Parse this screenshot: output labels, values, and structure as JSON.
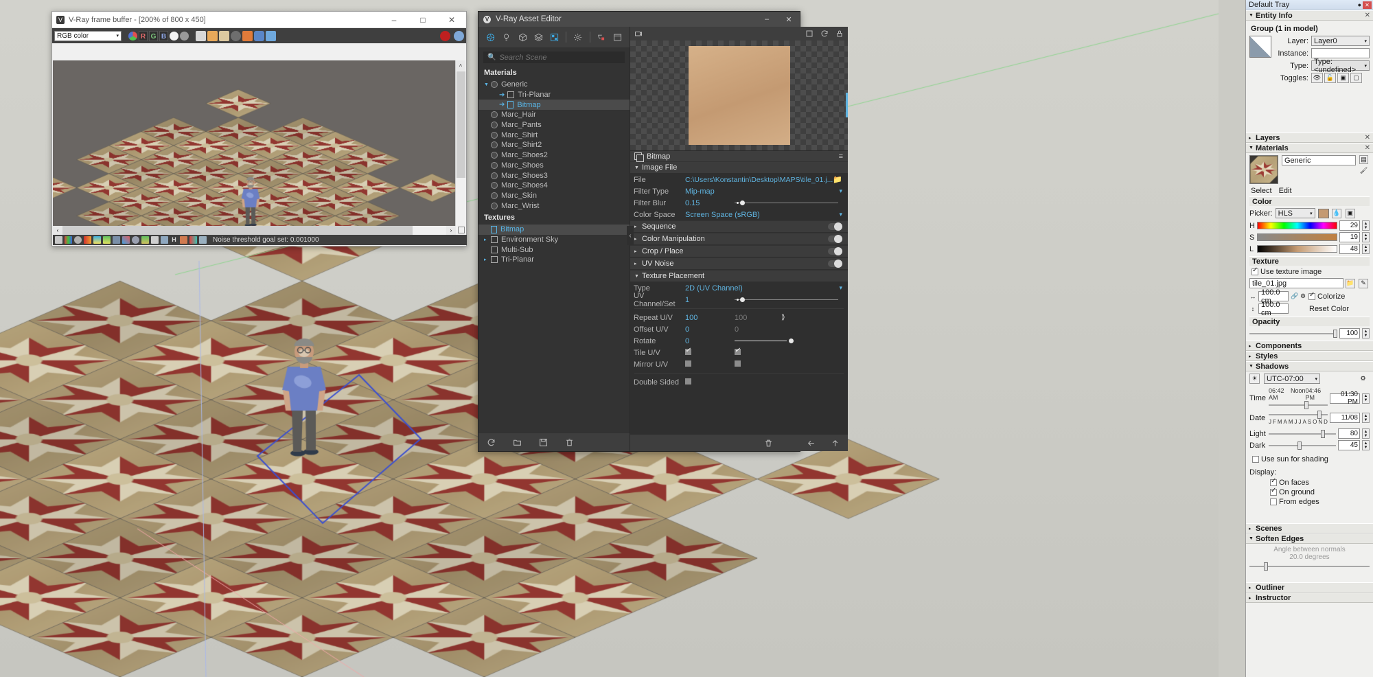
{
  "app": {
    "viewport_name": "sketchup-viewport"
  },
  "vfb": {
    "title": "V-Ray frame buffer - [200% of 800 x 450]",
    "title_icon": "vray-logo-icon",
    "minimize": "–",
    "maximize": "□",
    "close": "✕",
    "channel_select": "RGB color",
    "toolbar_icons": [
      "color-channels-icon",
      "red-channel-icon",
      "green-channel-icon",
      "blue-channel-icon",
      "alpha-icon",
      "monochrome-icon",
      "save-icon",
      "open-icon",
      "clipboard-icon",
      "clear-icon",
      "region-render-icon",
      "vray-teapot-icon",
      "stereo-icon"
    ],
    "toolbar_right_icons": [
      "stop-render-icon",
      "vray-render-icon"
    ],
    "status_text": "Noise threshold goal set: 0.001000",
    "status_icons": [
      "layers-icon",
      "color-corrections-icon",
      "info-icon",
      "exposure-icon",
      "hsl-icon",
      "color-balance-icon",
      "curve-icon",
      "lut-icon",
      "white-balance-icon",
      "hue-icon",
      "lens-effects-icon",
      "vignette-icon",
      "levels-icon",
      "h-icon",
      "compare-icon",
      "background-icon",
      "denoiser-icon"
    ],
    "scroll_up": "˄",
    "scroll_down": "˅",
    "scroll_left": "‹",
    "scroll_right": "›"
  },
  "asset_editor": {
    "title": "V-Ray Asset Editor",
    "title_icon": "vray-logo-icon",
    "minimize": "–",
    "maximize": "□",
    "close": "✕",
    "toolbar": [
      {
        "name": "materials-icon",
        "active": true
      },
      {
        "name": "lights-icon",
        "active": false
      },
      {
        "name": "geometry-icon",
        "active": false
      },
      {
        "name": "render-elements-icon",
        "active": false
      },
      {
        "name": "textures-icon",
        "active": true
      },
      {
        "name": "settings-gear-icon",
        "active": false
      },
      {
        "name": "render-with-vray-icon",
        "active": false
      },
      {
        "name": "frame-buffer-icon",
        "active": false
      }
    ],
    "search_placeholder": "Search Scene",
    "search_value": "",
    "search_icon": "search-icon",
    "tree": [
      {
        "type": "group",
        "label": "Materials"
      },
      {
        "type": "item",
        "label": "Generic",
        "icon": "sphere-icon",
        "indent": 0,
        "twisty": "▼",
        "selected": false
      },
      {
        "type": "item",
        "label": "Tri-Planar",
        "icon": "square-icon",
        "indent": 1,
        "arrow": "➔",
        "selected": false
      },
      {
        "type": "item",
        "label": "Bitmap",
        "icon": "doc-icon",
        "indent": 1,
        "arrow": "➔",
        "selected": true
      },
      {
        "type": "item",
        "label": "Marc_Hair",
        "icon": "sphere-icon",
        "indent": 0,
        "selected": false
      },
      {
        "type": "item",
        "label": "Marc_Pants",
        "icon": "sphere-icon",
        "indent": 0,
        "selected": false
      },
      {
        "type": "item",
        "label": "Marc_Shirt",
        "icon": "sphere-icon",
        "indent": 0,
        "selected": false
      },
      {
        "type": "item",
        "label": "Marc_Shirt2",
        "icon": "sphere-icon",
        "indent": 0,
        "selected": false
      },
      {
        "type": "item",
        "label": "Marc_Shoes2",
        "icon": "sphere-icon",
        "indent": 0,
        "selected": false
      },
      {
        "type": "item",
        "label": "Marc_Shoes",
        "icon": "sphere-icon",
        "indent": 0,
        "selected": false
      },
      {
        "type": "item",
        "label": "Marc_Shoes3",
        "icon": "sphere-icon",
        "indent": 0,
        "selected": false
      },
      {
        "type": "item",
        "label": "Marc_Shoes4",
        "icon": "sphere-icon",
        "indent": 0,
        "selected": false
      },
      {
        "type": "item",
        "label": "Marc_Skin",
        "icon": "sphere-icon",
        "indent": 0,
        "selected": false
      },
      {
        "type": "item",
        "label": "Marc_Wrist",
        "icon": "sphere-icon",
        "indent": 0,
        "selected": false
      },
      {
        "type": "group",
        "label": "Textures"
      },
      {
        "type": "item",
        "label": "Bitmap",
        "icon": "doc-icon",
        "indent": 0,
        "selected": true,
        "blue": true
      },
      {
        "type": "item",
        "label": "Environment Sky",
        "icon": "square-icon",
        "indent": 0,
        "twisty": "▸",
        "selected": false
      },
      {
        "type": "item",
        "label": "Multi-Sub",
        "icon": "square-icon",
        "indent": 0,
        "selected": false
      },
      {
        "type": "item",
        "label": "Tri-Planar",
        "icon": "square-icon",
        "indent": 0,
        "twisty": "▸",
        "selected": false
      }
    ],
    "left_footer_icons": [
      "refresh-icon",
      "open-folder-icon",
      "save-icon",
      "delete-icon"
    ],
    "right_footer_icons": [
      "purge-icon"
    ],
    "nav_icons": [
      "back-arrow-icon",
      "up-arrow-icon"
    ],
    "collapse_handle": "‹",
    "preview": {
      "camera_icon": "preview-camera-icon",
      "resize_icon": "maximize-preview-icon",
      "refresh_icon": "refresh-preview-icon",
      "lock_icon": "lock-preview-icon",
      "swatch_color": "#c89b72"
    },
    "prop_header": {
      "icon": "bitmap-icon",
      "title": "Bitmap",
      "menu": "≡"
    },
    "sections": {
      "image_file": {
        "label": "Image File",
        "expanded": true,
        "tri": "▼",
        "rows": [
          {
            "label": "File",
            "value": "C:\\Users\\Konstantin\\Desktop\\MAPS\\tile_01.j...",
            "control": "file",
            "icon": "folder-icon"
          },
          {
            "label": "Filter Type",
            "value": "Mip-map",
            "control": "dropdown",
            "chev": "▾"
          },
          {
            "label": "Filter Blur",
            "value": "0.15",
            "control": "slider",
            "knob_pct": 5
          },
          {
            "label": "Color Space",
            "value": "Screen Space (sRGB)",
            "control": "dropdown",
            "chev": "▾"
          }
        ]
      },
      "collapsed": [
        {
          "label": "Sequence",
          "tri": "▸",
          "toggle": true
        },
        {
          "label": "Color Manipulation",
          "tri": "▸",
          "toggle": false
        },
        {
          "label": "Crop / Place",
          "tri": "▸",
          "toggle": false
        },
        {
          "label": "UV Noise",
          "tri": "▸",
          "toggle": true
        }
      ],
      "texture_placement": {
        "label": "Texture Placement",
        "tri": "▼",
        "rows": [
          {
            "label": "Type",
            "value": "2D (UV Channel)",
            "control": "dropdown",
            "chev": "▾"
          },
          {
            "label": "UV Channel/Set",
            "value": "1",
            "control": "slider",
            "knob_pct": 5
          }
        ],
        "rows2": [
          {
            "label": "Repeat U/V",
            "u": "100",
            "v": "100",
            "control": "pair",
            "link_icon": "link-icon"
          },
          {
            "label": "Offset U/V",
            "u": "0",
            "v": "0",
            "control": "pair"
          },
          {
            "label": "Rotate",
            "u": "0",
            "control": "slider",
            "knob_pct": 52
          },
          {
            "label": "Tile U/V",
            "u_checked": true,
            "v_checked": true,
            "control": "checks"
          },
          {
            "label": "Mirror U/V",
            "u_checked": false,
            "v_checked": false,
            "control": "checks"
          },
          {
            "label": "Double Sided",
            "u_checked": false,
            "control": "check1"
          }
        ]
      }
    }
  },
  "tray": {
    "title": "Default Tray",
    "pin_icon": "pin-icon",
    "close_icon": "close-icon",
    "panels": [
      {
        "name": "entity-info",
        "label": "Entity Info",
        "tri": "▼",
        "close": "✕"
      },
      {
        "name": "layers",
        "label": "Layers",
        "tri": "▸",
        "close": "✕"
      },
      {
        "name": "materials",
        "label": "Materials",
        "tri": "▼",
        "close": "✕"
      },
      {
        "name": "components",
        "label": "Components",
        "tri": "▸",
        "close": ""
      },
      {
        "name": "styles",
        "label": "Styles",
        "tri": "▸",
        "close": ""
      },
      {
        "name": "shadows",
        "label": "Shadows",
        "tri": "▼",
        "close": ""
      },
      {
        "name": "scenes",
        "label": "Scenes",
        "tri": "▸",
        "close": ""
      },
      {
        "name": "soften-edges",
        "label": "Soften Edges",
        "tri": "▼",
        "close": ""
      },
      {
        "name": "outliner",
        "label": "Outliner",
        "tri": "▸",
        "close": ""
      },
      {
        "name": "instructor",
        "label": "Instructor",
        "tri": "▸",
        "close": ""
      }
    ],
    "entity_info": {
      "heading": "Group (1 in model)",
      "thumb_icon": "group-thumbnail",
      "layer_label": "Layer:",
      "layer_value": "Layer0",
      "instance_label": "Instance:",
      "instance_value": "",
      "type_label": "Type:",
      "type_value": "Type: <undefined>",
      "toggles_label": "Toggles:",
      "toggles": [
        "eye-icon",
        "unlock-icon",
        "cast-shadows-icon",
        "receive-shadows-icon"
      ]
    },
    "materials": {
      "swatch_name": "material-thumbnail",
      "name_value": "Generic",
      "select_tab": "Select",
      "edit_tab": "Edit",
      "color_label": "Color",
      "picker_label": "Picker:",
      "picker_value": "HLS",
      "h_label": "H",
      "h_value": "29",
      "s_label": "S",
      "s_value": "19",
      "l_label": "L",
      "l_value": "48",
      "texture_label": "Texture",
      "use_texture_label": "Use texture image",
      "use_texture_checked": true,
      "texture_file": "tile_01.jpg",
      "width_value": "100.0 cm",
      "height_value": "100.0 cm",
      "colorize_label": "Colorize",
      "colorize_checked": true,
      "reset_color_label": "Reset Color",
      "opacity_label": "Opacity",
      "opacity_value": "100",
      "browse_icon": "browse-icon",
      "eyedropper_icon": "eyedropper-icon",
      "matte_icon": "matte-icon",
      "lock_icon": "link-lock-icon"
    },
    "shadows": {
      "play_icon": "shadow-display-icon",
      "timezone": "UTC-07:00",
      "settings_icon": "shadow-settings-icon",
      "time_label": "Time",
      "time_start": "06:42 AM",
      "time_noon": "Noon",
      "time_end": "04:46 PM",
      "time_value": "01:30 PM",
      "date_label": "Date",
      "date_value": "11/08",
      "months": [
        "J",
        "F",
        "M",
        "A",
        "M",
        "J",
        "J",
        "A",
        "S",
        "O",
        "N",
        "D"
      ],
      "light_label": "Light",
      "light_value": "80",
      "dark_label": "Dark",
      "dark_value": "45",
      "use_sun_label": "Use sun for shading",
      "use_sun_checked": false,
      "display_label": "Display:",
      "on_faces_label": "On faces",
      "on_faces_checked": true,
      "on_ground_label": "On ground",
      "on_ground_checked": true,
      "from_edges_label": "From edges",
      "from_edges_checked": false
    },
    "soften_edges": {
      "angle_label": "Angle between normals",
      "angle_value": "20.0  degrees"
    }
  }
}
